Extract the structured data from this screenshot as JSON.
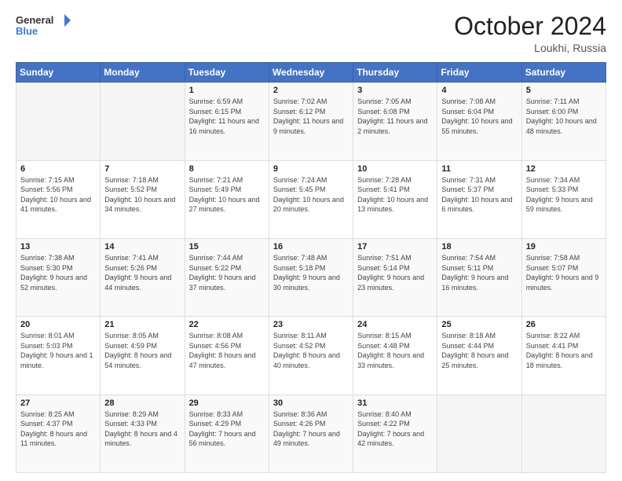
{
  "header": {
    "logo_general": "General",
    "logo_blue": "Blue",
    "month_title": "October 2024",
    "location": "Loukhi, Russia"
  },
  "days_of_week": [
    "Sunday",
    "Monday",
    "Tuesday",
    "Wednesday",
    "Thursday",
    "Friday",
    "Saturday"
  ],
  "weeks": [
    [
      {
        "day": "",
        "sunrise": "",
        "sunset": "",
        "daylight": "",
        "empty": true
      },
      {
        "day": "",
        "sunrise": "",
        "sunset": "",
        "daylight": "",
        "empty": true
      },
      {
        "day": "1",
        "sunrise": "Sunrise: 6:59 AM",
        "sunset": "Sunset: 6:15 PM",
        "daylight": "Daylight: 11 hours and 16 minutes."
      },
      {
        "day": "2",
        "sunrise": "Sunrise: 7:02 AM",
        "sunset": "Sunset: 6:12 PM",
        "daylight": "Daylight: 11 hours and 9 minutes."
      },
      {
        "day": "3",
        "sunrise": "Sunrise: 7:05 AM",
        "sunset": "Sunset: 6:08 PM",
        "daylight": "Daylight: 11 hours and 2 minutes."
      },
      {
        "day": "4",
        "sunrise": "Sunrise: 7:08 AM",
        "sunset": "Sunset: 6:04 PM",
        "daylight": "Daylight: 10 hours and 55 minutes."
      },
      {
        "day": "5",
        "sunrise": "Sunrise: 7:11 AM",
        "sunset": "Sunset: 6:00 PM",
        "daylight": "Daylight: 10 hours and 48 minutes."
      }
    ],
    [
      {
        "day": "6",
        "sunrise": "Sunrise: 7:15 AM",
        "sunset": "Sunset: 5:56 PM",
        "daylight": "Daylight: 10 hours and 41 minutes."
      },
      {
        "day": "7",
        "sunrise": "Sunrise: 7:18 AM",
        "sunset": "Sunset: 5:52 PM",
        "daylight": "Daylight: 10 hours and 34 minutes."
      },
      {
        "day": "8",
        "sunrise": "Sunrise: 7:21 AM",
        "sunset": "Sunset: 5:49 PM",
        "daylight": "Daylight: 10 hours and 27 minutes."
      },
      {
        "day": "9",
        "sunrise": "Sunrise: 7:24 AM",
        "sunset": "Sunset: 5:45 PM",
        "daylight": "Daylight: 10 hours and 20 minutes."
      },
      {
        "day": "10",
        "sunrise": "Sunrise: 7:28 AM",
        "sunset": "Sunset: 5:41 PM",
        "daylight": "Daylight: 10 hours and 13 minutes."
      },
      {
        "day": "11",
        "sunrise": "Sunrise: 7:31 AM",
        "sunset": "Sunset: 5:37 PM",
        "daylight": "Daylight: 10 hours and 6 minutes."
      },
      {
        "day": "12",
        "sunrise": "Sunrise: 7:34 AM",
        "sunset": "Sunset: 5:33 PM",
        "daylight": "Daylight: 9 hours and 59 minutes."
      }
    ],
    [
      {
        "day": "13",
        "sunrise": "Sunrise: 7:38 AM",
        "sunset": "Sunset: 5:30 PM",
        "daylight": "Daylight: 9 hours and 52 minutes."
      },
      {
        "day": "14",
        "sunrise": "Sunrise: 7:41 AM",
        "sunset": "Sunset: 5:26 PM",
        "daylight": "Daylight: 9 hours and 44 minutes."
      },
      {
        "day": "15",
        "sunrise": "Sunrise: 7:44 AM",
        "sunset": "Sunset: 5:22 PM",
        "daylight": "Daylight: 9 hours and 37 minutes."
      },
      {
        "day": "16",
        "sunrise": "Sunrise: 7:48 AM",
        "sunset": "Sunset: 5:18 PM",
        "daylight": "Daylight: 9 hours and 30 minutes."
      },
      {
        "day": "17",
        "sunrise": "Sunrise: 7:51 AM",
        "sunset": "Sunset: 5:14 PM",
        "daylight": "Daylight: 9 hours and 23 minutes."
      },
      {
        "day": "18",
        "sunrise": "Sunrise: 7:54 AM",
        "sunset": "Sunset: 5:11 PM",
        "daylight": "Daylight: 9 hours and 16 minutes."
      },
      {
        "day": "19",
        "sunrise": "Sunrise: 7:58 AM",
        "sunset": "Sunset: 5:07 PM",
        "daylight": "Daylight: 9 hours and 9 minutes."
      }
    ],
    [
      {
        "day": "20",
        "sunrise": "Sunrise: 8:01 AM",
        "sunset": "Sunset: 5:03 PM",
        "daylight": "Daylight: 9 hours and 1 minute."
      },
      {
        "day": "21",
        "sunrise": "Sunrise: 8:05 AM",
        "sunset": "Sunset: 4:59 PM",
        "daylight": "Daylight: 8 hours and 54 minutes."
      },
      {
        "day": "22",
        "sunrise": "Sunrise: 8:08 AM",
        "sunset": "Sunset: 4:56 PM",
        "daylight": "Daylight: 8 hours and 47 minutes."
      },
      {
        "day": "23",
        "sunrise": "Sunrise: 8:11 AM",
        "sunset": "Sunset: 4:52 PM",
        "daylight": "Daylight: 8 hours and 40 minutes."
      },
      {
        "day": "24",
        "sunrise": "Sunrise: 8:15 AM",
        "sunset": "Sunset: 4:48 PM",
        "daylight": "Daylight: 8 hours and 33 minutes."
      },
      {
        "day": "25",
        "sunrise": "Sunrise: 8:18 AM",
        "sunset": "Sunset: 4:44 PM",
        "daylight": "Daylight: 8 hours and 25 minutes."
      },
      {
        "day": "26",
        "sunrise": "Sunrise: 8:22 AM",
        "sunset": "Sunset: 4:41 PM",
        "daylight": "Daylight: 8 hours and 18 minutes."
      }
    ],
    [
      {
        "day": "27",
        "sunrise": "Sunrise: 8:25 AM",
        "sunset": "Sunset: 4:37 PM",
        "daylight": "Daylight: 8 hours and 11 minutes."
      },
      {
        "day": "28",
        "sunrise": "Sunrise: 8:29 AM",
        "sunset": "Sunset: 4:33 PM",
        "daylight": "Daylight: 8 hours and 4 minutes."
      },
      {
        "day": "29",
        "sunrise": "Sunrise: 8:33 AM",
        "sunset": "Sunset: 4:29 PM",
        "daylight": "Daylight: 7 hours and 56 minutes."
      },
      {
        "day": "30",
        "sunrise": "Sunrise: 8:36 AM",
        "sunset": "Sunset: 4:26 PM",
        "daylight": "Daylight: 7 hours and 49 minutes."
      },
      {
        "day": "31",
        "sunrise": "Sunrise: 8:40 AM",
        "sunset": "Sunset: 4:22 PM",
        "daylight": "Daylight: 7 hours and 42 minutes."
      },
      {
        "day": "",
        "sunrise": "",
        "sunset": "",
        "daylight": "",
        "empty": true
      },
      {
        "day": "",
        "sunrise": "",
        "sunset": "",
        "daylight": "",
        "empty": true
      }
    ]
  ]
}
